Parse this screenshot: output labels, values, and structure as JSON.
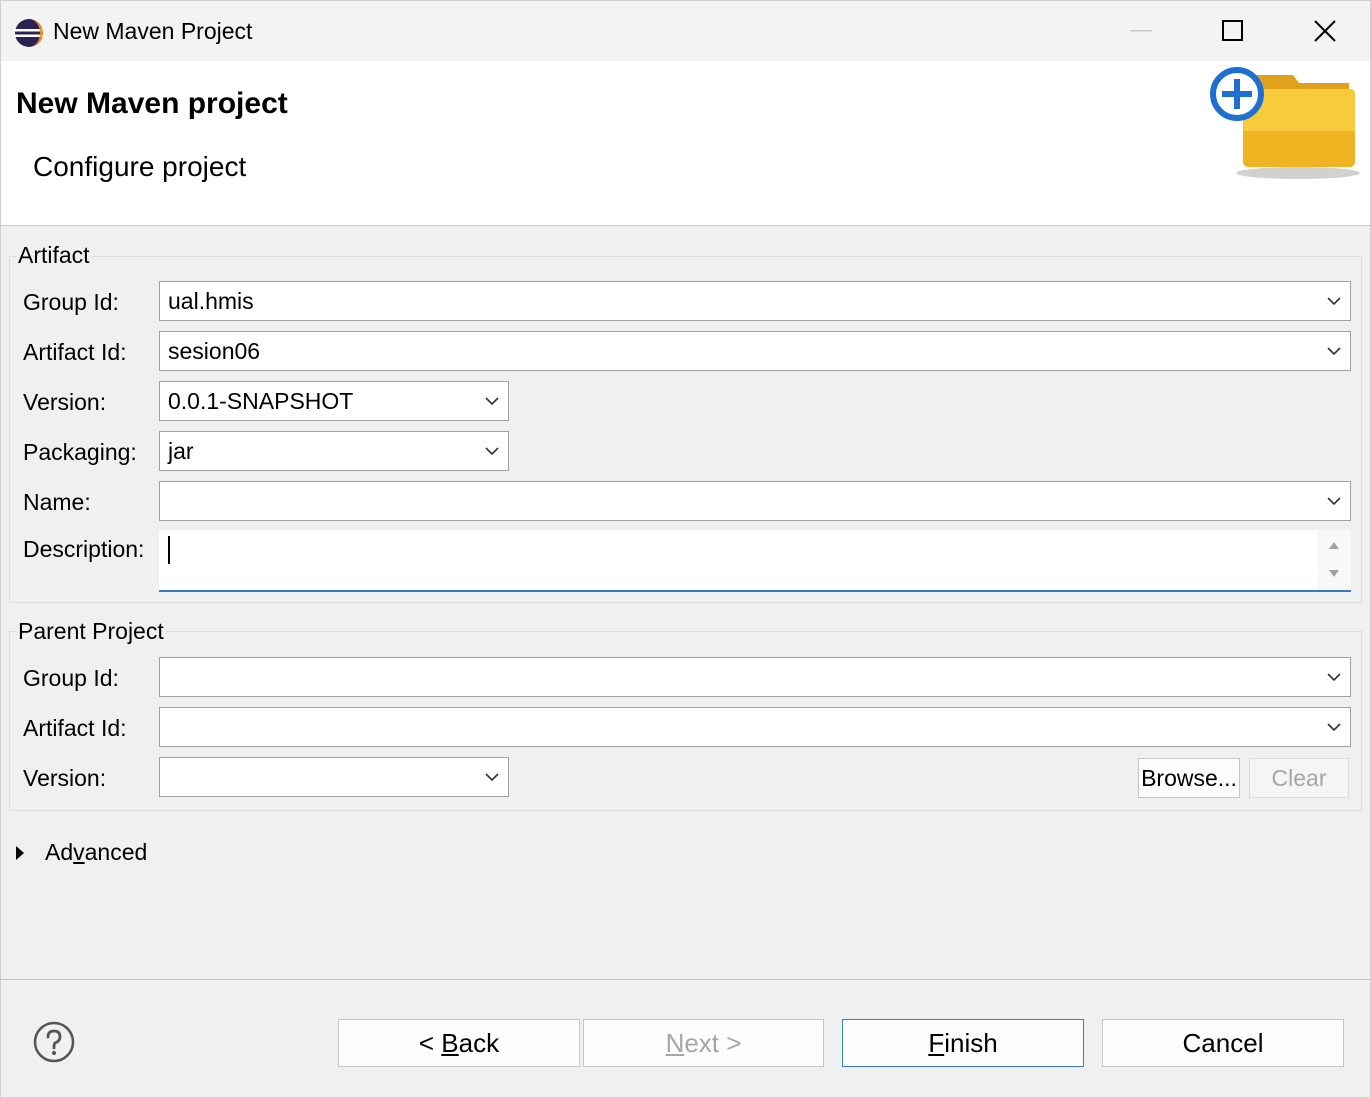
{
  "window": {
    "title": "New Maven Project"
  },
  "banner": {
    "title": "New Maven project",
    "subtitle": "Configure project"
  },
  "artifact": {
    "group_label": "Artifact",
    "group_id_label": "Group Id:",
    "group_id_value": "ual.hmis",
    "artifact_id_label": "Artifact Id:",
    "artifact_id_value": "sesion06",
    "version_label": "Version:",
    "version_value": "0.0.1-SNAPSHOT",
    "packaging_label": "Packaging:",
    "packaging_value": "jar",
    "name_label": "Name:",
    "name_value": "",
    "description_label": "Description:",
    "description_value": ""
  },
  "parent": {
    "group_label": "Parent Project",
    "group_id_label": "Group Id:",
    "group_id_value": "",
    "artifact_id_label": "Artifact Id:",
    "artifact_id_value": "",
    "version_label": "Version:",
    "version_value": "",
    "browse_label": "Browse...",
    "clear_label": "Clear"
  },
  "advanced": {
    "label_pre": "Ad",
    "label_mnemonic": "v",
    "label_post": "anced"
  },
  "footer": {
    "back_pre": "< ",
    "back_mnemonic": "B",
    "back_post": "ack",
    "next_mnemonic": "N",
    "next_post": "ext >",
    "finish_mnemonic": "F",
    "finish_post": "inish",
    "cancel_label": "Cancel"
  },
  "icons": {
    "app": "eclipse-icon",
    "banner": "new-folder-icon",
    "help": "help-icon"
  },
  "colors": {
    "accent": "#3a7bd5",
    "folder": "#f5c12e",
    "plus": "#1f6fd1"
  }
}
